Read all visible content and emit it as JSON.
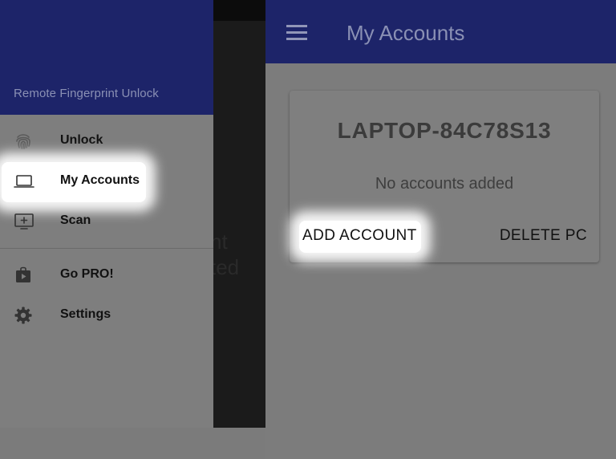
{
  "drawer": {
    "subtitle": "Remote Fingerprint Unlock",
    "items": [
      {
        "label": "Unlock",
        "icon": "fingerprint-icon"
      },
      {
        "label": "My Accounts",
        "icon": "laptop-icon",
        "highlighted": true
      },
      {
        "label": "Scan",
        "icon": "monitor-add-icon"
      },
      {
        "label": "Go PRO!",
        "icon": "play-store-icon"
      },
      {
        "label": "Settings",
        "icon": "gear-icon"
      }
    ]
  },
  "background_text": [
    "nt",
    "ted"
  ],
  "app_bar": {
    "title": "My Accounts",
    "menu_icon": "hamburger-menu-icon"
  },
  "pc_card": {
    "name": "LAPTOP-84C78S13",
    "status": "No accounts added",
    "add_label": "ADD ACCOUNT",
    "delete_label": "DELETE PC"
  },
  "colors": {
    "primary": "#1d2469",
    "dimmed_background": "#7c7c7c",
    "highlight": "#ffffff"
  }
}
